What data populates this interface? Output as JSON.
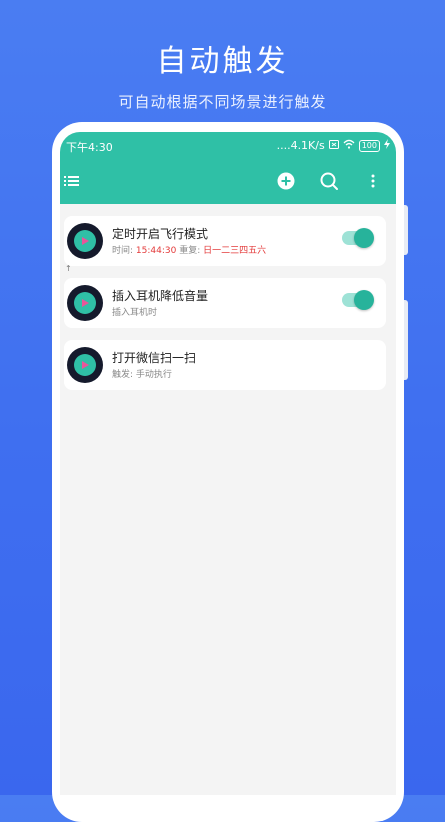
{
  "promo": {
    "title": "自动触发",
    "subtitle": "可自动根据不同场景进行触发"
  },
  "status_bar": {
    "time": "下午4:30",
    "network_speed": "....4.1K/s",
    "battery": "100"
  },
  "toolbar": {
    "menu_icon": "list-menu-icon",
    "add_icon": "plus-circle-icon",
    "search_icon": "search-icon",
    "more_icon": "more-vertical-icon",
    "accent_color": "#2fc0a6"
  },
  "tasks": [
    {
      "title": "定时开启飞行模式",
      "sub_prefix": "时间: ",
      "time_value": "15:44:30",
      "repeat_prefix": " 重复: ",
      "repeat_value": "日一二三四五六",
      "toggle_on": true
    },
    {
      "title": "插入耳机降低音量",
      "sub": "插入耳机时",
      "toggle_on": true
    },
    {
      "title": "打开微信扫一扫",
      "sub": "触发: 手动执行"
    }
  ]
}
